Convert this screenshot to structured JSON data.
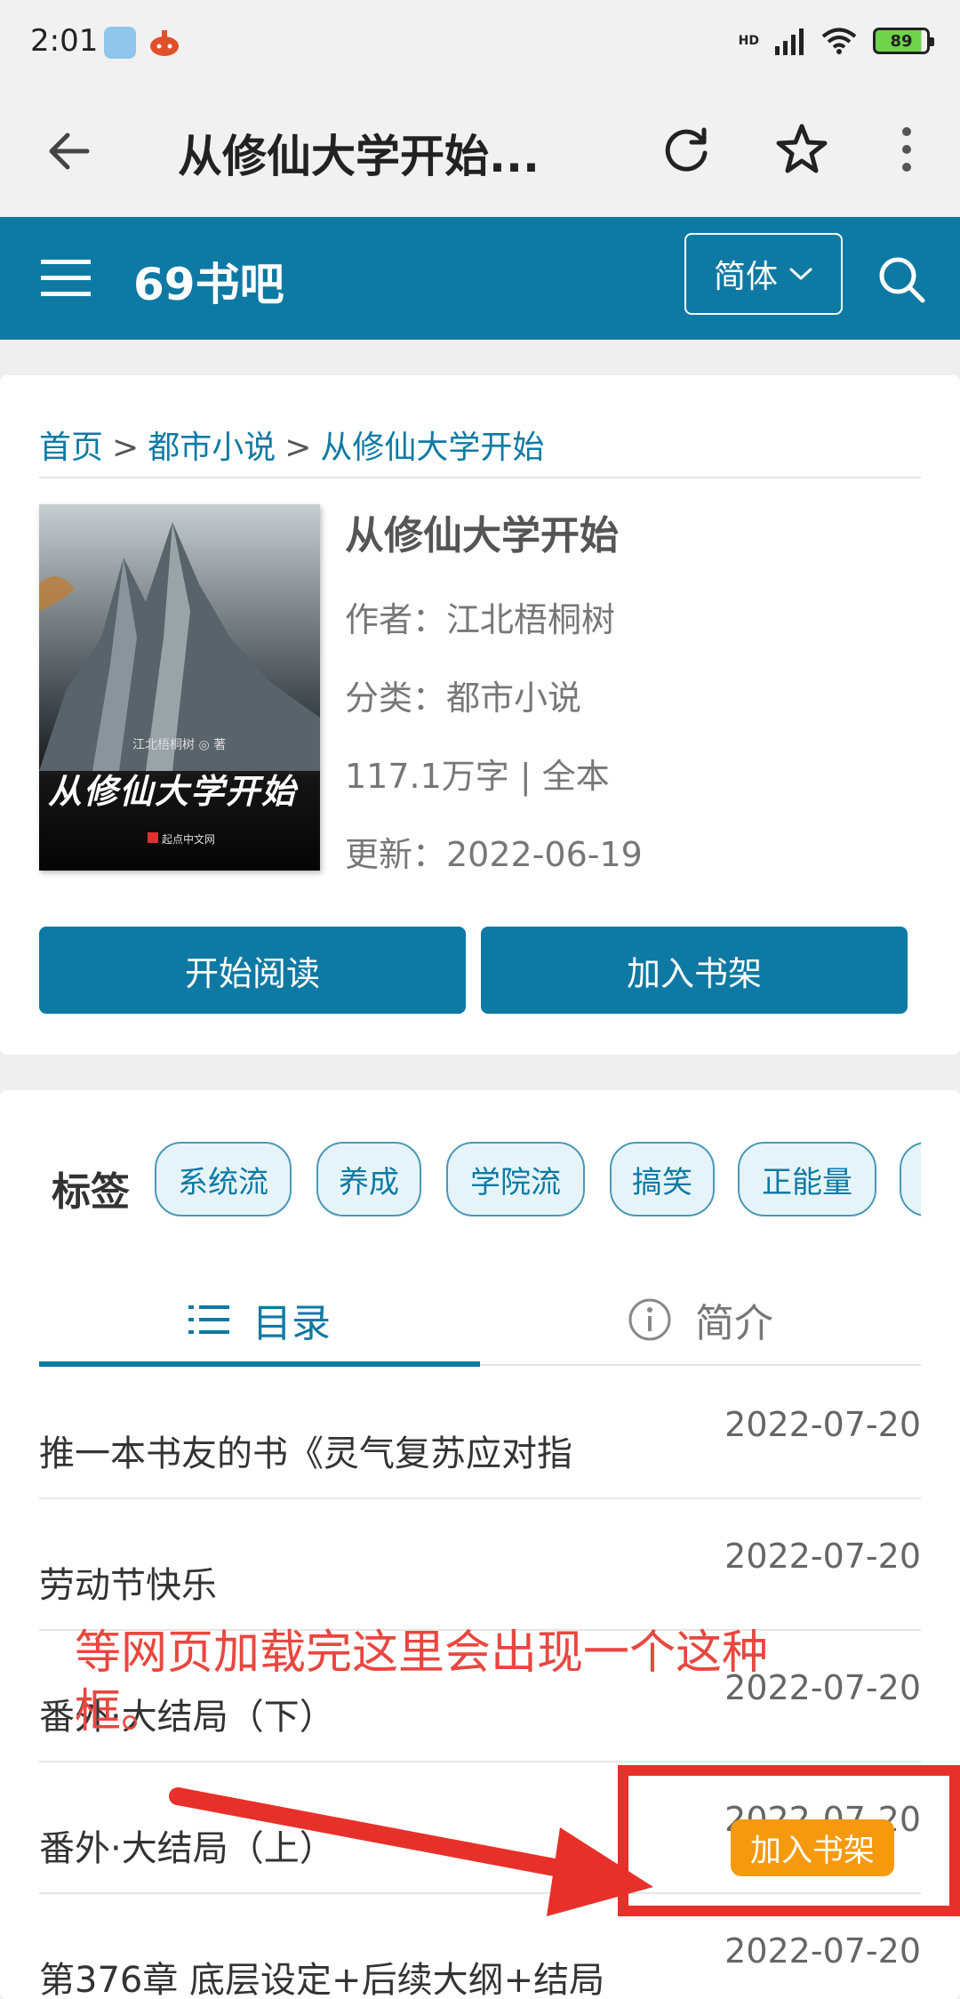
{
  "status_bar": {
    "time": "2:01",
    "hd_label": "HD",
    "battery": "89"
  },
  "browser": {
    "title": "从修仙大学开始..."
  },
  "site": {
    "name": "69书吧",
    "lang_select": "简体"
  },
  "breadcrumb": {
    "home": "首页",
    "sep": ">",
    "category": "都市小说",
    "book": "从修仙大学开始"
  },
  "cover": {
    "author": "江北梧桐树 ◎ 著",
    "title": "从修仙大学开始",
    "publisher": "起点中文网"
  },
  "book": {
    "title": "从修仙大学开始",
    "author": "作者：江北梧桐树",
    "category": "分类：都市小说",
    "stats": "117.1万字 | 全本",
    "updated": "更新：2022-06-19",
    "read_button": "开始阅读",
    "shelf_button": "加入书架"
  },
  "tags": {
    "label": "标签",
    "items": [
      "系统流",
      "养成",
      "学院流",
      "搞笑",
      "正能量"
    ]
  },
  "tabs": {
    "toc": "目录",
    "intro": "简介"
  },
  "chapters": [
    {
      "title": "推一本书友的书《灵气复苏应对指",
      "date": "2022-07-20"
    },
    {
      "title": "劳动节快乐",
      "date": "2022-07-20"
    },
    {
      "title": "番外·大结局（下）",
      "date": "2022-07-20"
    },
    {
      "title": "番外·大结局（上）",
      "date": "2022-07-20"
    },
    {
      "title": "第376章 底层设定+后续大纲+结局",
      "date": "2022-07-20"
    }
  ],
  "annotation": {
    "text": "等网页加载完这里会出现一个这种框。",
    "floating_button": "加入书架"
  },
  "colors": {
    "brand": "#0e7aa4",
    "annotation_red": "#e8302a",
    "floating_orange": "#f59a0f"
  }
}
